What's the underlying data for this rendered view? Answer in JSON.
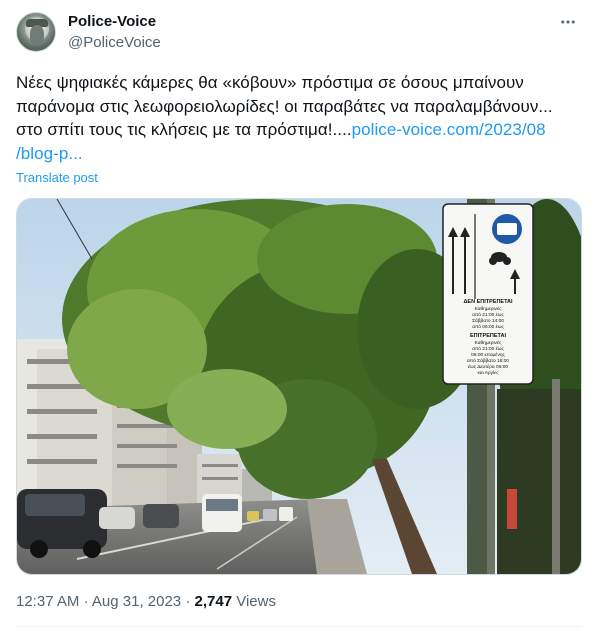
{
  "author": {
    "display_name": "Police-Voice",
    "handle": "@PoliceVoice",
    "avatar_icon": "police-officer-avatar"
  },
  "more_icon": "more-horizontal-icon",
  "post": {
    "line1": "Νέες ψηφιακές κάμερες θα «κόβουν» πρόστιμα σε όσους μπαίνουν",
    "line2": "παράνομα στις λεωφορειολωρίδες!   οι παραβάτες να παραλαμβάνουν...",
    "line3_text": "στο σπίτι τους τις κλήσεις με τα πρόστιμα!....",
    "line3_link": "police-voice.com/2023/08",
    "line4_link": "/blog-p..."
  },
  "translate_label": "Translate post",
  "sign": {
    "line1": "ΔΕΝ ΕΠΙΤΡΕΠΕΤΑΙ",
    "line2": "Καθημερινές",
    "line3": "από 21:00 έως",
    "line4": "Σάββατο 14:00",
    "line5": "από 06:00 έως",
    "line6": "ΕΠΙΤΡΕΠΕΤΑΙ",
    "line7": "Καθημερινές",
    "line8": "από 21:00 έως",
    "line9": "06:00 επομένης",
    "line10": "από Σάββατο 16:00",
    "line11": "έως Δευτέρα 06:00",
    "line12": "και Αργίες"
  },
  "meta": {
    "time": "12:37 AM",
    "separator": "·",
    "date": "Aug 31, 2023",
    "views_count": "2,747",
    "views_label": "Views"
  },
  "colors": {
    "link": "#1d9bf0",
    "secondary": "#536471",
    "text": "#0f1419"
  }
}
